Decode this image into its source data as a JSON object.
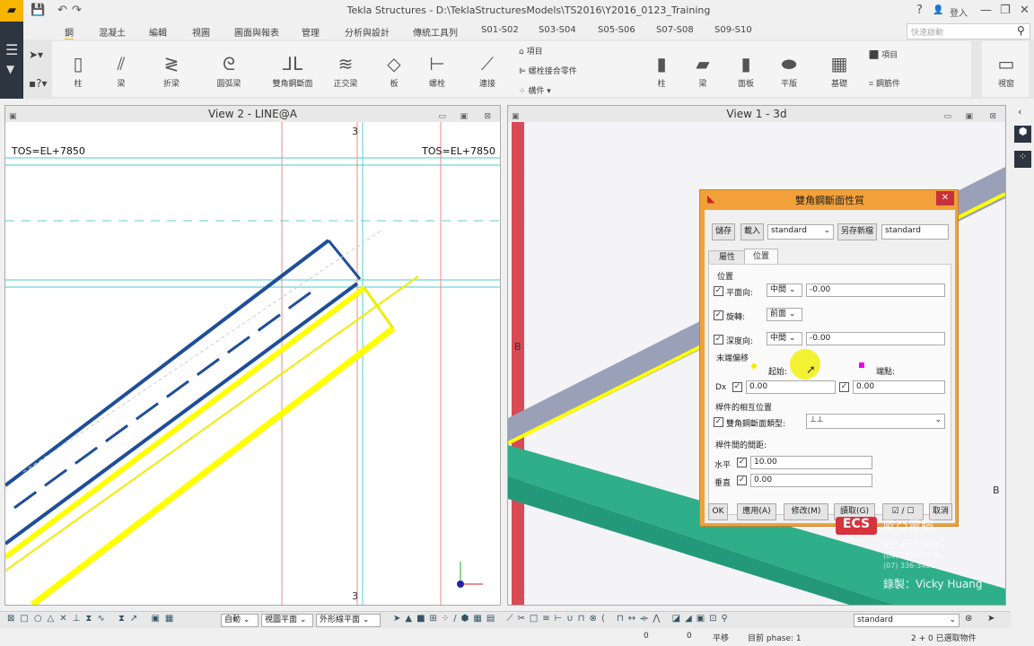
{
  "app": {
    "title": "Tekla Structures - D:\\TeklaStructuresModels\\TS2016\\Y2016_0123_Training",
    "login": "登入",
    "help": "?"
  },
  "tabs": [
    "鋼",
    "混凝土",
    "編輯",
    "視圖",
    "圖面與報表",
    "管理",
    "分析與設計",
    "傳統工具列",
    "S01-S02",
    "S03-S04",
    "S05-S06",
    "S07-S08",
    "S09-S10"
  ],
  "search_placeholder": "快速啟動",
  "ribbon": {
    "steel": [
      "柱",
      "梁",
      "折梁",
      "圓弧梁",
      "雙角鋼斷面",
      "正交梁",
      "板",
      "螺栓",
      "連接"
    ],
    "steel_small": [
      "項目",
      "螺栓接合零件",
      "構件"
    ],
    "concrete": [
      "柱",
      "梁",
      "面板",
      "平版",
      "基礎"
    ],
    "concrete_small": [
      "項目",
      "鋼筋件"
    ],
    "view": "視窗"
  },
  "view2": {
    "title": "View 2 - LINE@A",
    "tos_left": "TOS=EL+7850",
    "tos_right": "TOS=EL+7850",
    "grid_top": "3",
    "grid_bottom": "3"
  },
  "view1": {
    "title": "View 1 - 3d",
    "grid_b1": "B",
    "grid_b2": "B"
  },
  "dialog": {
    "title": "雙角鋼斷面性質",
    "save": "儲存",
    "load": "載入",
    "preset": "standard",
    "save_as": "另存新檔",
    "save_as_name": "standard",
    "tab_attr": "屬性",
    "tab_pos": "位置",
    "section_pos": "位置",
    "plane_label": "平面向:",
    "plane_sel": "中間",
    "plane_val": "-0.00",
    "rot_label": "旋轉:",
    "rot_sel": "前面",
    "depth_label": "深度向:",
    "depth_sel": "中間",
    "depth_val": "-0.00",
    "end_offset": "末端偏移",
    "start": "起始:",
    "end": "端點:",
    "dx": "Dx",
    "dx_start": "0.00",
    "dx_end": "0.00",
    "relative": "桿件的相互位置",
    "type_label": "雙角鋼斷面類型:",
    "type_val": "⊥⊥",
    "spacing": "桿件間的間距:",
    "horiz": "水平",
    "horiz_val": "10.00",
    "vert": "垂直",
    "vert_val": "0.00",
    "ok": "OK",
    "apply": "應用(A)",
    "modify": "修改(M)",
    "get": "讀取(G)",
    "toggle": "☑ / ☐",
    "cancel": "取消"
  },
  "watermark": {
    "brand": "ECS 歐亞電腦",
    "phones": [
      "(02) 8712-2966",
      "(04) 2239-3476",
      "(07) 336-3461"
    ],
    "recorder": "錄製：Vicky Huang"
  },
  "toolbar": {
    "snap": "自動",
    "plane": "視圖平面",
    "outline": "外形線平面",
    "filter": "standard"
  },
  "status": {
    "x": "0",
    "y": "0",
    "mode": "平移",
    "phase": "目前 phase: 1",
    "selected": "2 + 0 已選取物件"
  }
}
